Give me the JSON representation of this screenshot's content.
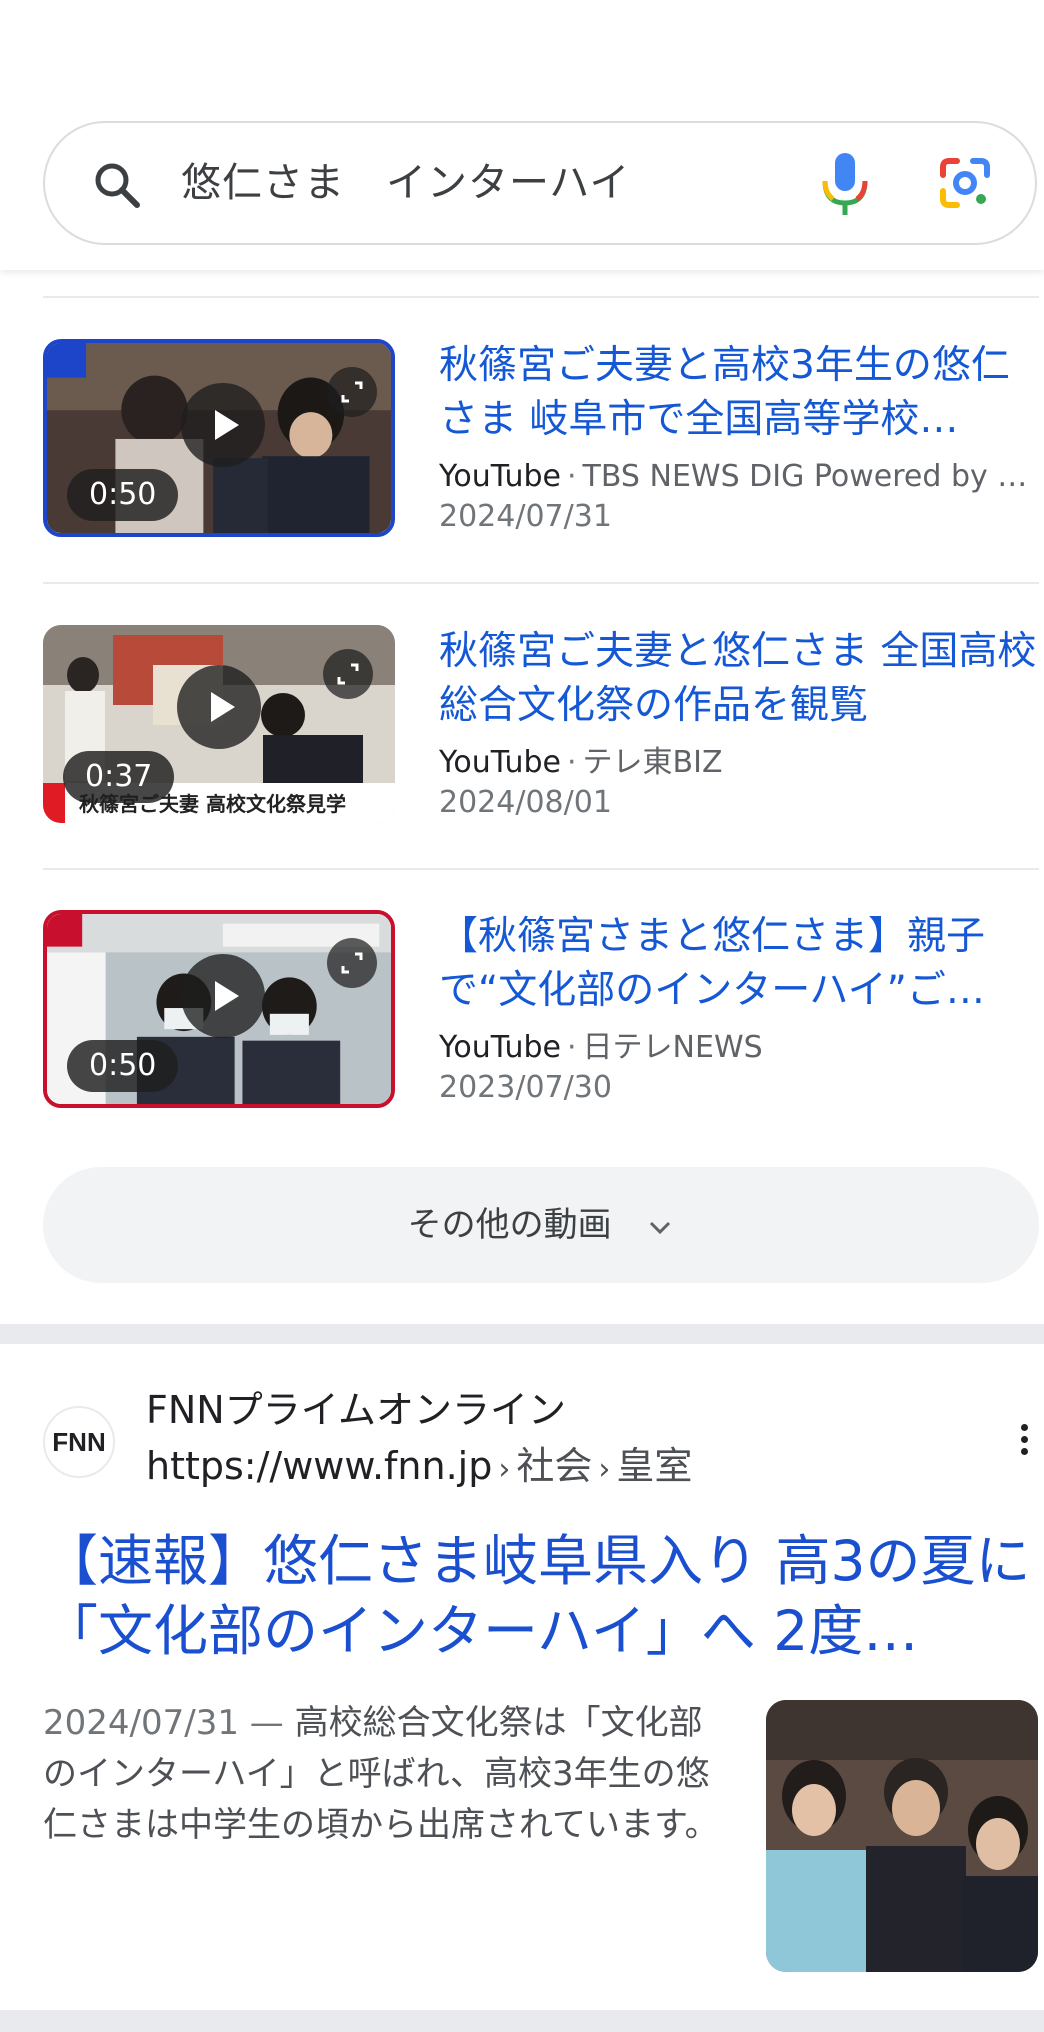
{
  "search": {
    "query": "悠仁さま　インターハイ",
    "icons": {
      "search": "search-icon",
      "mic": "mic-icon",
      "lens": "lens-icon"
    }
  },
  "videos": [
    {
      "title": "秋篠宮ご夫妻と高校3年生の悠仁さま 岐阜市で全国高等学校…",
      "site": "YouTube",
      "separator": "·",
      "channel": "TBS NEWS DIG Powered by …",
      "date": "2024/07/31",
      "duration": "0:50",
      "frame_color": "#1d45c9"
    },
    {
      "title": "秋篠宮ご夫妻と悠仁さま 全国高校総合文化祭の作品を観覧",
      "site": "YouTube",
      "separator": "·",
      "channel": "テレ東BIZ",
      "date": "2024/08/01",
      "duration": "0:37",
      "caption": "秋篠宮ご夫妻 高校文化祭見学"
    },
    {
      "title": "【秋篠宮さまと悠仁さま】親子で“文化部のインターハイ”ご…",
      "site": "YouTube",
      "separator": "·",
      "channel": "日テレNEWS",
      "date": "2023/07/30",
      "duration": "0:50",
      "frame_color": "#c8102e"
    }
  ],
  "more_videos": {
    "label": "その他の動画"
  },
  "web_result": {
    "favicon_text": "FNN",
    "site_name": "FNNプライムオンライン",
    "url_base": "https://www.fnn.jp",
    "breadcrumbs": [
      "社会",
      "皇室"
    ],
    "breadcrumb_sep": "›",
    "title": "【速報】悠仁さま岐阜県入り 高3の夏に「文化部のインターハイ」へ 2度…",
    "snippet_date": "2024/07/31 —",
    "snippet": "高校総合文化祭は「文化部のインターハイ」と呼ばれ、高校3年生の悠仁さまは中学生の頃から出席されています。"
  },
  "colors": {
    "link_blue": "#1558d6",
    "title_blue": "#1a4fd0",
    "pill_bg": "#f1f3f4",
    "divider": "#e8eaed"
  }
}
